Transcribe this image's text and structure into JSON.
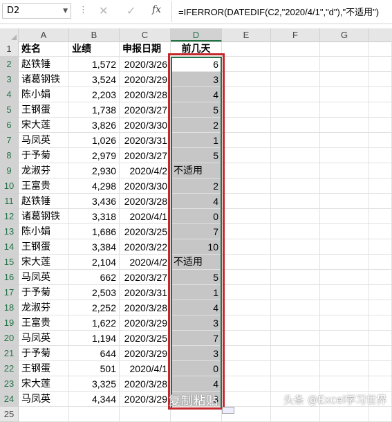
{
  "formula_bar": {
    "name_box": "D2",
    "cancel_icon": "cancel-icon",
    "enter_icon": "check-icon",
    "fx_label": "fx",
    "formula": "=IFERROR(DATEDIF(C2,\"2020/4/1\",\"d\"),\"不适用\")"
  },
  "columns": [
    "A",
    "B",
    "C",
    "D",
    "E",
    "F",
    "G"
  ],
  "selected_column": "D",
  "headers": {
    "a": "姓名",
    "b": "业绩",
    "c": "申报日期",
    "d": "前几天"
  },
  "rows": [
    {
      "n": "1"
    },
    {
      "n": "2",
      "a": "赵铁锤",
      "b": "1,572",
      "c": "2020/3/26",
      "d": "6"
    },
    {
      "n": "3",
      "a": "诸葛钢铁",
      "b": "3,524",
      "c": "2020/3/29",
      "d": "3"
    },
    {
      "n": "4",
      "a": "陈小娟",
      "b": "2,203",
      "c": "2020/3/28",
      "d": "4"
    },
    {
      "n": "5",
      "a": "王钢蛋",
      "b": "1,738",
      "c": "2020/3/27",
      "d": "5"
    },
    {
      "n": "6",
      "a": "宋大莲",
      "b": "3,826",
      "c": "2020/3/30",
      "d": "2"
    },
    {
      "n": "7",
      "a": "马凤英",
      "b": "1,026",
      "c": "2020/3/31",
      "d": "1"
    },
    {
      "n": "8",
      "a": "于予菊",
      "b": "2,979",
      "c": "2020/3/27",
      "d": "5"
    },
    {
      "n": "9",
      "a": "龙淑芬",
      "b": "2,930",
      "c": "2020/4/2",
      "d": "不适用"
    },
    {
      "n": "10",
      "a": "王富贵",
      "b": "4,298",
      "c": "2020/3/30",
      "d": "2"
    },
    {
      "n": "11",
      "a": "赵铁锤",
      "b": "3,436",
      "c": "2020/3/28",
      "d": "4"
    },
    {
      "n": "12",
      "a": "诸葛钢铁",
      "b": "3,318",
      "c": "2020/4/1",
      "d": "0"
    },
    {
      "n": "13",
      "a": "陈小娟",
      "b": "1,686",
      "c": "2020/3/25",
      "d": "7"
    },
    {
      "n": "14",
      "a": "王钢蛋",
      "b": "3,384",
      "c": "2020/3/22",
      "d": "10"
    },
    {
      "n": "15",
      "a": "宋大莲",
      "b": "2,104",
      "c": "2020/4/2",
      "d": "不适用"
    },
    {
      "n": "16",
      "a": "马凤英",
      "b": "662",
      "c": "2020/3/27",
      "d": "5"
    },
    {
      "n": "17",
      "a": "于予菊",
      "b": "2,503",
      "c": "2020/3/31",
      "d": "1"
    },
    {
      "n": "18",
      "a": "龙淑芬",
      "b": "2,252",
      "c": "2020/3/28",
      "d": "4"
    },
    {
      "n": "19",
      "a": "王富贵",
      "b": "1,622",
      "c": "2020/3/29",
      "d": "3"
    },
    {
      "n": "20",
      "a": "马凤英",
      "b": "1,194",
      "c": "2020/3/25",
      "d": "7"
    },
    {
      "n": "21",
      "a": "于予菊",
      "b": "644",
      "c": "2020/3/29",
      "d": "3"
    },
    {
      "n": "22",
      "a": "王钢蛋",
      "b": "501",
      "c": "2020/4/1",
      "d": "0"
    },
    {
      "n": "23",
      "a": "宋大莲",
      "b": "3,325",
      "c": "2020/3/28",
      "d": "4"
    },
    {
      "n": "24",
      "a": "马凤英",
      "b": "4,344",
      "c": "2020/3/29",
      "d": "3"
    },
    {
      "n": "25"
    }
  ],
  "watermark": {
    "left": "复制粘贴",
    "right": "头条 @Excel学习世界"
  },
  "colors": {
    "selection_green": "#217346",
    "highlight_red": "#c4282d",
    "selected_fill": "#c6c6c6"
  }
}
